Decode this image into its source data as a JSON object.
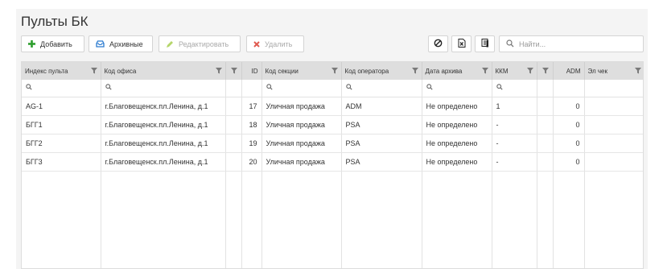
{
  "page_title": "Пульты БК",
  "toolbar": {
    "add_label": "Добавить",
    "archive_label": "Архивные",
    "edit_label": "Редактировать",
    "delete_label": "Удалить",
    "search_placeholder": "Найти..."
  },
  "colors": {
    "add_icon": "#2e9e2e",
    "archive_icon": "#2b7bd0",
    "edit_icon": "#b5d66a",
    "delete_icon": "#e05a4f",
    "header_bg": "#dedede",
    "panel_bg": "#f4f4f4"
  },
  "table": {
    "columns": [
      {
        "label": "Индекс пульта"
      },
      {
        "label": "Код офиса"
      },
      {
        "label": ""
      },
      {
        "label": "ID"
      },
      {
        "label": "Код секции"
      },
      {
        "label": "Код оператора"
      },
      {
        "label": "Дата архива"
      },
      {
        "label": "ККМ"
      },
      {
        "label": ""
      },
      {
        "label": "ADM"
      },
      {
        "label": "Эл чек"
      }
    ],
    "rows": [
      [
        "AG-1",
        "г.Благовещенск.пл.Ленина, д.1",
        "",
        "17",
        "Уличная продажа",
        "ADM",
        "Не определено",
        "1",
        "",
        "0",
        ""
      ],
      [
        "БГГ1",
        "г.Благовещенск.пл.Ленина, д.1",
        "",
        "18",
        "Уличная продажа",
        "PSA",
        "Не определено",
        "-",
        "",
        "0",
        ""
      ],
      [
        "БГГ2",
        "г.Благовещенск.пл.Ленина, д.1",
        "",
        "19",
        "Уличная продажа",
        "PSA",
        "Не определено",
        "-",
        "",
        "0",
        ""
      ],
      [
        "БГГ3",
        "г.Благовещенск.пл.Ленина, д.1",
        "",
        "20",
        "Уличная продажа",
        "PSA",
        "Не определено",
        "-",
        "",
        "0",
        ""
      ]
    ]
  }
}
